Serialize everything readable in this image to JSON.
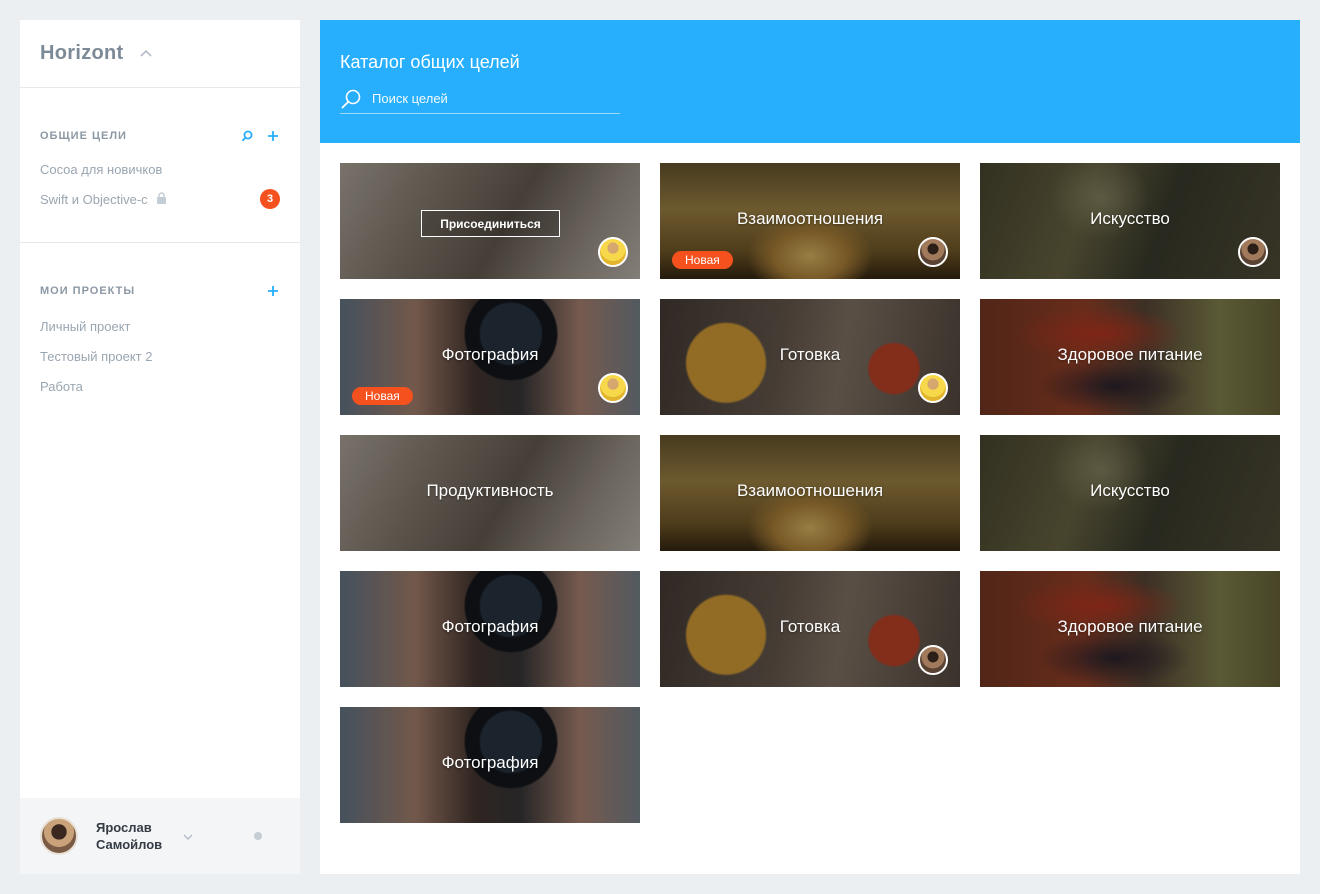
{
  "sidebar": {
    "brand": "Horizont",
    "goals": {
      "title": "ОБЩИЕ ЦЕЛИ",
      "items": [
        {
          "label": "Cocoa для новичков"
        },
        {
          "label": "Swift и Objective-c",
          "locked": true,
          "badge": "3"
        }
      ]
    },
    "projects": {
      "title": "МОИ ПРОЕКТЫ",
      "items": [
        {
          "label": "Личный проект"
        },
        {
          "label": "Тестовый проект 2"
        },
        {
          "label": "Работа"
        }
      ]
    },
    "user": {
      "name": "Ярослав Самойлов"
    }
  },
  "main": {
    "title": "Каталог общих целей",
    "search_placeholder": "Поиск целей",
    "join_label": "Присоединиться",
    "new_label": "Новая",
    "cards": [
      {
        "title": "",
        "image": "laptop",
        "join": true,
        "avatar": "yellow"
      },
      {
        "title": "Взаимоотношения",
        "image": "heart",
        "new": true,
        "avatar": "dark"
      },
      {
        "title": "Искусство",
        "image": "art",
        "avatar": "dark"
      },
      {
        "title": "Фотография",
        "image": "camera",
        "new": true,
        "avatar": "yellow"
      },
      {
        "title": "Готовка",
        "image": "food",
        "avatar": "yellow"
      },
      {
        "title": "Здоровое питание",
        "image": "veg"
      },
      {
        "title": "Продуктивность",
        "image": "laptop"
      },
      {
        "title": "Взаимоотношения",
        "image": "heart"
      },
      {
        "title": "Искусство",
        "image": "art"
      },
      {
        "title": "Фотография",
        "image": "camera"
      },
      {
        "title": "Готовка",
        "image": "food",
        "avatar": "dark"
      },
      {
        "title": "Здоровое питание",
        "image": "veg"
      },
      {
        "title": "Фотография",
        "image": "camera"
      }
    ]
  },
  "colors": {
    "accent": "#27aefc",
    "badge": "#f4511e",
    "background": "#eceff2"
  },
  "icons": [
    "chevron-up-icon",
    "search-icon",
    "plus-icon",
    "lock-icon",
    "chevron-down-icon"
  ]
}
